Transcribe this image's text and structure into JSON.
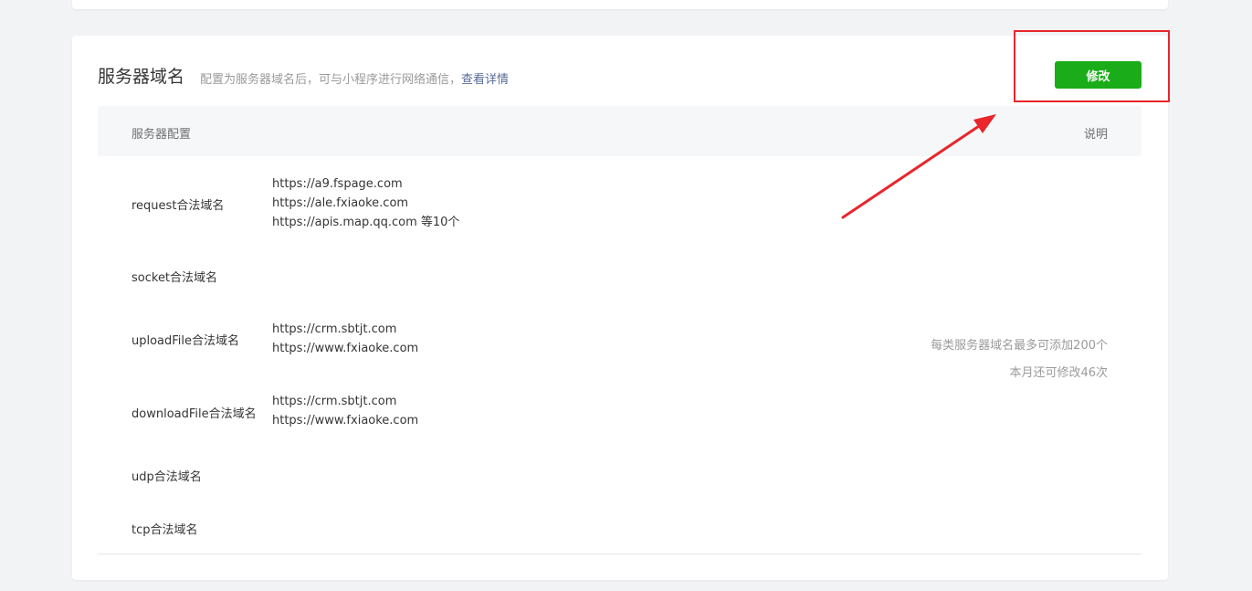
{
  "section": {
    "title": "服务器域名",
    "description": "配置为服务器域名后，可与小程序进行网络通信，",
    "details_link": "查看详情",
    "edit_button": "修改"
  },
  "table": {
    "col_config": "服务器配置",
    "col_notes": "说明",
    "rows": [
      {
        "label": "request合法域名",
        "values": [
          "https://a9.fspage.com",
          "https://ale.fxiaoke.com",
          "https://apis.map.qq.com 等10个"
        ]
      },
      {
        "label": "socket合法域名",
        "values": []
      },
      {
        "label": "uploadFile合法域名",
        "values": [
          "https://crm.sbtjt.com",
          "https://www.fxiaoke.com"
        ]
      },
      {
        "label": "downloadFile合法域名",
        "values": [
          "https://crm.sbtjt.com",
          "https://www.fxiaoke.com"
        ]
      },
      {
        "label": "udp合法域名",
        "values": []
      },
      {
        "label": "tcp合法域名",
        "values": []
      }
    ],
    "notes": [
      "每类服务器域名最多可添加200个",
      "本月还可修改46次"
    ]
  },
  "colors": {
    "accent_green": "#1aad19",
    "annotation_red": "#e8262b",
    "link_blue": "#576b95"
  }
}
